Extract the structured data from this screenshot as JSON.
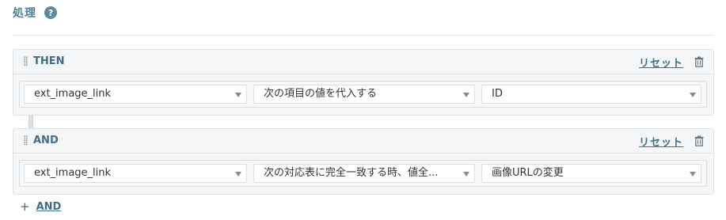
{
  "section": {
    "title": "処理",
    "help_glyph": "?"
  },
  "rules": [
    {
      "label": "THEN",
      "reset_label": "リセット",
      "fields": [
        "ext_image_link",
        "次の項目の値を代入する",
        "ID"
      ]
    },
    {
      "label": "AND",
      "reset_label": "リセット",
      "fields": [
        "ext_image_link",
        "次の対応表に完全一致する時、値全...",
        "画像URLの変更"
      ]
    }
  ],
  "add_button": {
    "plus": "+",
    "label": "AND"
  },
  "icons": {
    "help": "question-circle-icon",
    "drag": "drag-handle-icon",
    "trash": "trash-icon",
    "caret": "caret-down-icon"
  },
  "colors": {
    "accent": "#3e6f88",
    "help_bg": "#5e8aa0"
  }
}
